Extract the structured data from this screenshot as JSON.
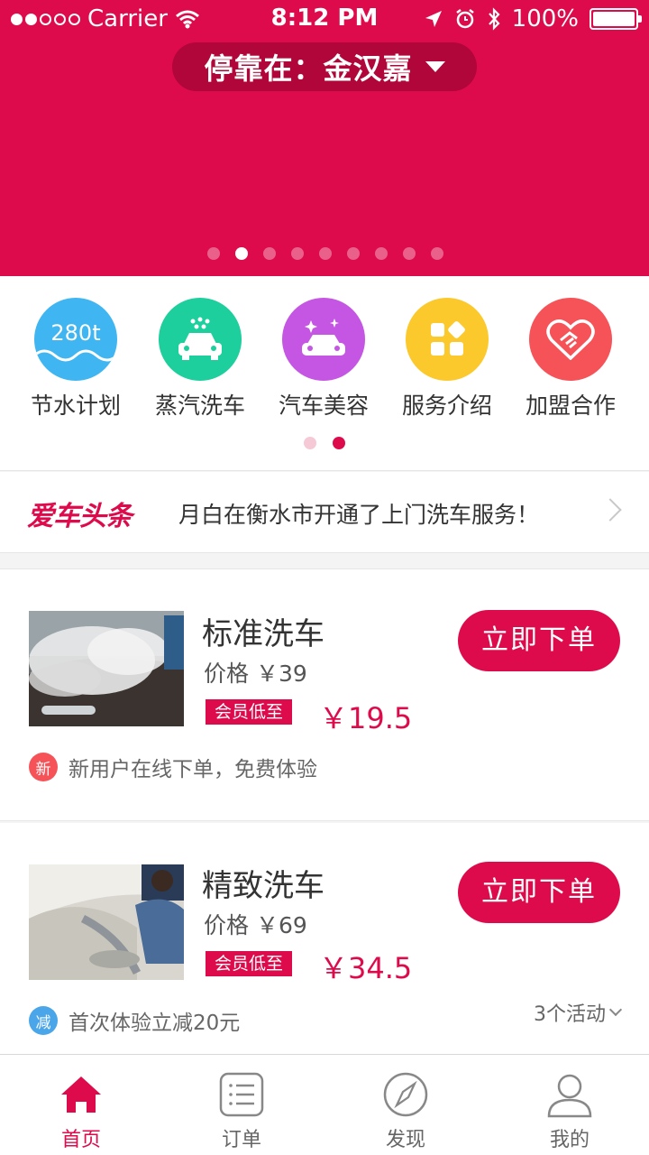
{
  "status_bar": {
    "carrier": "Carrier",
    "time": "8:12 PM",
    "battery": "100%"
  },
  "header": {
    "location_prefix": "停靠在：",
    "location": "金汉嘉"
  },
  "banner": {
    "total_pages": 9,
    "active_page": 2
  },
  "categories": [
    {
      "label": "节水计划",
      "icon_text": "280t",
      "icon": "water-wave-icon",
      "color": "#3fb5f2"
    },
    {
      "label": "蒸汽洗车",
      "icon": "steam-car-icon",
      "color": "#1ccf9c"
    },
    {
      "label": "汽车美容",
      "icon": "sparkle-car-icon",
      "color": "#c456e3"
    },
    {
      "label": "服务介绍",
      "icon": "grid-apps-icon",
      "color": "#fcc92c"
    },
    {
      "label": "加盟合作",
      "icon": "heart-handshake-icon",
      "color": "#f65359"
    }
  ],
  "news": {
    "brand": "爱车头条",
    "text": "月白在衡水市开通了上门洗车服务！"
  },
  "products": [
    {
      "name": "标准洗车",
      "price": "价格 ￥39",
      "member_tag": "会员低至",
      "member_price": "￥19.5",
      "order_label": "立即下单",
      "promo_badge": "新",
      "promo_color": "#f65359",
      "promo_text": "新用户在线下单，免费体验"
    },
    {
      "name": "精致洗车",
      "price": "价格 ￥69",
      "member_tag": "会员低至",
      "member_price": "￥34.5",
      "order_label": "立即下单",
      "promo_badge": "减",
      "promo_color": "#4aa6e8",
      "promo_text": "首次体验立减20元",
      "activities": "3个活动"
    }
  ],
  "tabs": [
    {
      "label": "首页",
      "icon": "home-icon",
      "active": true
    },
    {
      "label": "订单",
      "icon": "order-list-icon",
      "active": false
    },
    {
      "label": "发现",
      "icon": "compass-icon",
      "active": false
    },
    {
      "label": "我的",
      "icon": "person-icon",
      "active": false
    }
  ],
  "colors": {
    "accent": "#de0b4c"
  }
}
